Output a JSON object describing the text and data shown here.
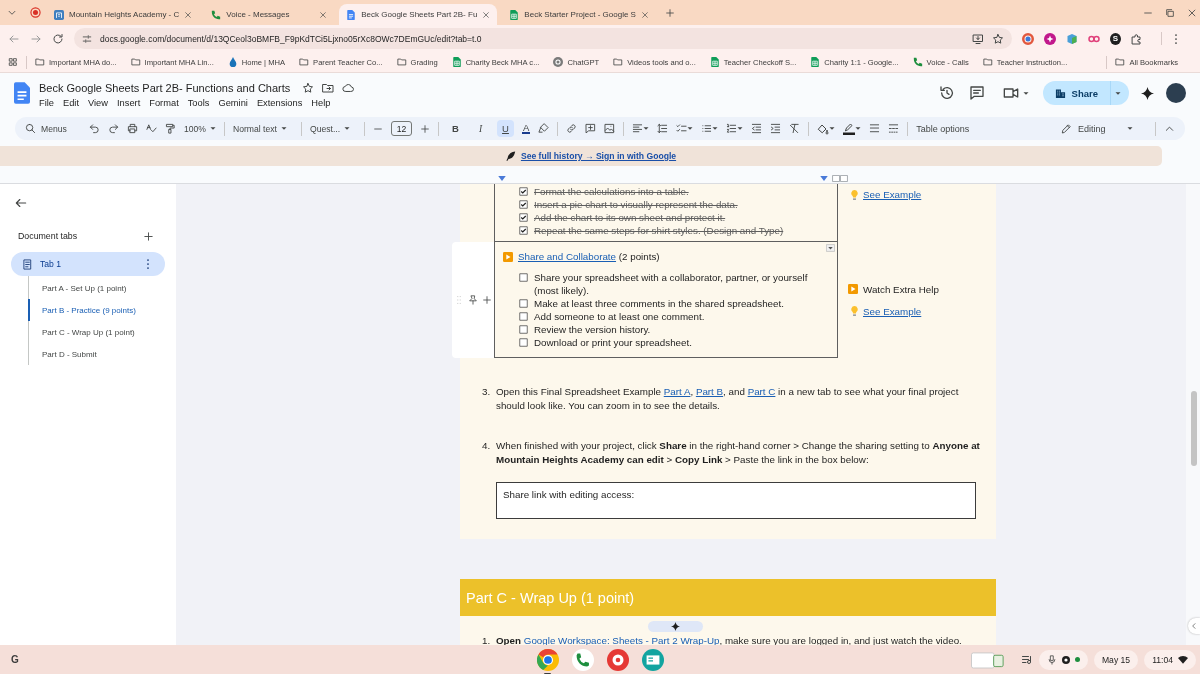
{
  "browser": {
    "tabs": [
      {
        "title": "Mountain Heights Academy - C",
        "kind": "site",
        "selected": false
      },
      {
        "title": "Voice - Messages",
        "kind": "voice",
        "selected": false
      },
      {
        "title": "Beck Google Sheets Part 2B- Fu",
        "kind": "docs",
        "selected": true
      },
      {
        "title": "Beck Starter Project - Google S",
        "kind": "sheets",
        "selected": false
      }
    ],
    "address": "docs.google.com/document/d/13QCeol3oBMFB_F9pKdTCi5Ljxno05rXc8OWc7DEmGUc/edit?tab=t.0",
    "extension_letter": "S",
    "bookmarks": [
      {
        "label": "Important MHA do...",
        "kind": "folder"
      },
      {
        "label": "Important MHA Lin...",
        "kind": "folder"
      },
      {
        "label": "Home | MHA",
        "kind": "drop"
      },
      {
        "label": "Parent Teacher Co...",
        "kind": "folder"
      },
      {
        "label": "Grading",
        "kind": "folder"
      },
      {
        "label": "Charity Beck MHA c...",
        "kind": "sheets"
      },
      {
        "label": "ChatGPT",
        "kind": "chatgpt"
      },
      {
        "label": "Videos tools and o...",
        "kind": "folder"
      },
      {
        "label": "Teacher Checkoff S...",
        "kind": "sheets"
      },
      {
        "label": "Charity 1:1 - Google...",
        "kind": "sheets"
      },
      {
        "label": "Voice - Calls",
        "kind": "voice"
      },
      {
        "label": "Teacher Instruction...",
        "kind": "folder"
      }
    ],
    "all_bookmarks": "All Bookmarks"
  },
  "docs": {
    "title": "Beck Google Sheets Part 2B- Functions and Charts",
    "menu": [
      "File",
      "Edit",
      "View",
      "Insert",
      "Format",
      "Tools",
      "Gemini",
      "Extensions",
      "Help"
    ],
    "share": "Share",
    "toolbar": {
      "search": {
        "placeholder": "Menus"
      },
      "zoom": "100%",
      "style": "Normal text",
      "font": "Quest...",
      "size": "12",
      "format": [
        {
          "label": "B",
          "kind": "bold",
          "selected": false
        },
        {
          "label": "I",
          "kind": "italic",
          "selected": false
        },
        {
          "label": "U",
          "kind": "underline",
          "selected": true
        }
      ],
      "text_color": "A",
      "table_options": "Table options",
      "mode": "Editing"
    },
    "banner_link": "See full history → Sign in with Google"
  },
  "sidebar": {
    "heading": "Document tabs",
    "tabs": [
      {
        "label": "Tab 1",
        "selected": true,
        "children": [
          {
            "label": "Part A - Set Up (1 point)",
            "selected": false
          },
          {
            "label": "Part B - Practice (9 points)",
            "selected": true
          },
          {
            "label": "Part C - Wrap Up (1 point)",
            "selected": false
          },
          {
            "label": "Part D - Submit",
            "selected": false
          }
        ]
      }
    ]
  },
  "document": {
    "table": [
      {
        "hovered": false,
        "items": [
          {
            "text": "Format the calculations into a table.",
            "checked": true
          },
          {
            "text": "Insert a pie chart to visually represent the data.",
            "checked": true
          },
          {
            "text": "Add the chart to its own sheet and protect it.",
            "checked": true
          },
          {
            "text": "Repeat the same steps for shirt styles. (Design and Type)",
            "checked": true
          }
        ],
        "extras": [
          {
            "kind": "example",
            "text": "See Example"
          }
        ]
      },
      {
        "hovered": true,
        "title": [
          {
            "kind": "link",
            "text": "Share and Collaborate"
          },
          {
            "kind": "text",
            "text": " (2 points)"
          }
        ],
        "items": [
          {
            "text": "Share your spreadsheet with a collaborator, partner, or yourself (most likely).",
            "checked": false
          },
          {
            "text": "Make at least three comments in the shared spreadsheet.",
            "checked": false
          },
          {
            "text": "Add someone to at least one comment.",
            "checked": false
          },
          {
            "text": "Review the version history.",
            "checked": false
          },
          {
            "text": "Download or print your spreadsheet.",
            "checked": false
          }
        ],
        "extras": [
          {
            "kind": "video",
            "text": "Watch Extra Help"
          },
          {
            "kind": "example",
            "text": "See Example"
          }
        ]
      }
    ],
    "steps": [
      {
        "number": "3.",
        "parts": [
          {
            "kind": "text",
            "text": "Open this Final Spreadsheet Example "
          },
          {
            "kind": "link",
            "text": "Part A"
          },
          {
            "kind": "text",
            "text": ", "
          },
          {
            "kind": "link",
            "text": "Part B"
          },
          {
            "kind": "text",
            "text": ", and "
          },
          {
            "kind": "link",
            "text": "Part C"
          },
          {
            "kind": "text",
            "text": " in a new tab to see what your final project should look like. You can zoom in to see the details."
          }
        ]
      },
      {
        "number": "4.",
        "parts": [
          {
            "kind": "text",
            "text": "When finished with your project, click **Share** in the right-hand corner > Change the sharing setting to **Anyone at Mountain Heights Academy can edit** > **Copy Link** > Paste the link in the box below:"
          }
        ]
      }
    ],
    "answer_box": {
      "label": "Share link with editing access:"
    },
    "section_heading": "Part C - Wrap Up (1 point)",
    "section_steps": [
      {
        "number": "1.",
        "parts": [
          {
            "kind": "text",
            "text": "**Open** "
          },
          {
            "kind": "link",
            "text": "Google Workspace: Sheets - Part 2 Wrap-Up"
          },
          {
            "kind": "text",
            "text": ", make sure you are logged in, and just watch the video."
          }
        ]
      }
    ]
  },
  "taskbar": {
    "launcher": "G",
    "apps": [
      {
        "kind": "browser",
        "open": true
      },
      {
        "kind": "phone",
        "open": false
      },
      {
        "kind": "palette",
        "open": false
      },
      {
        "kind": "card",
        "open": false
      }
    ],
    "date": "May 15",
    "time": "11:04"
  }
}
